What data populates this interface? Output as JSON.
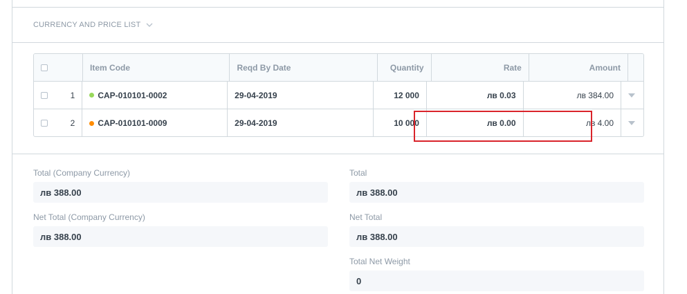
{
  "section": {
    "title": "CURRENCY AND PRICE LIST"
  },
  "table": {
    "columns": [
      "Item Code",
      "Reqd By Date",
      "Quantity",
      "Rate",
      "Amount"
    ],
    "rows": [
      {
        "idx": "1",
        "status_color": "#98d85b",
        "item_code": "CAP-010101-0002",
        "reqd_by_date": "29-04-2019",
        "quantity": "12 000",
        "rate": "лв 0.03",
        "amount": "лв 384.00"
      },
      {
        "idx": "2",
        "status_color": "#ff8c00",
        "item_code": "CAP-010101-0009",
        "reqd_by_date": "29-04-2019",
        "quantity": "10 000",
        "rate": "лв 0.00",
        "amount": "лв 4.00"
      }
    ]
  },
  "totals": {
    "total_company_currency": {
      "label": "Total (Company Currency)",
      "value": "лв 388.00"
    },
    "net_total_company_currency": {
      "label": "Net Total (Company Currency)",
      "value": "лв 388.00"
    },
    "total": {
      "label": "Total",
      "value": "лв 388.00"
    },
    "net_total": {
      "label": "Net Total",
      "value": "лв 388.00"
    },
    "total_net_weight": {
      "label": "Total Net Weight",
      "value": "0"
    }
  },
  "colors": {
    "highlight": "#d9232a",
    "border": "#d1d8dd",
    "muted_text": "#8d99a6"
  }
}
